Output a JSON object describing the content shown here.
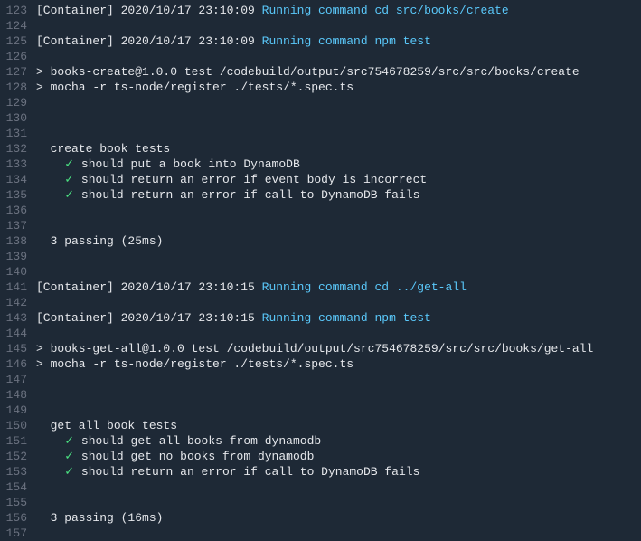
{
  "colors": {
    "bg": "#1e2936",
    "text": "#e5e7eb",
    "lineNumber": "#6b7280",
    "cyan": "#5ac8fa",
    "check": "#4ade80"
  },
  "lines": [
    {
      "num": 123,
      "segments": [
        {
          "text": "[Container] 2020/10/17 23:10:09 ",
          "cls": ""
        },
        {
          "text": "Running command cd src/books/create",
          "cls": "cyan"
        }
      ]
    },
    {
      "num": 124,
      "segments": []
    },
    {
      "num": 125,
      "segments": [
        {
          "text": "[Container] 2020/10/17 23:10:09 ",
          "cls": ""
        },
        {
          "text": "Running command npm test",
          "cls": "cyan"
        }
      ]
    },
    {
      "num": 126,
      "segments": []
    },
    {
      "num": 127,
      "segments": [
        {
          "text": "> books-create@1.0.0 test /codebuild/output/src754678259/src/src/books/create",
          "cls": ""
        }
      ]
    },
    {
      "num": 128,
      "segments": [
        {
          "text": "> mocha -r ts-node/register ./tests/*.spec.ts",
          "cls": ""
        }
      ]
    },
    {
      "num": 129,
      "segments": []
    },
    {
      "num": 130,
      "segments": []
    },
    {
      "num": 131,
      "segments": []
    },
    {
      "num": 132,
      "segments": [
        {
          "text": "  create book tests",
          "cls": ""
        }
      ]
    },
    {
      "num": 133,
      "segments": [
        {
          "text": "    ",
          "cls": ""
        },
        {
          "text": "✓",
          "cls": "check"
        },
        {
          "text": " should put a book into DynamoDB",
          "cls": ""
        }
      ]
    },
    {
      "num": 134,
      "segments": [
        {
          "text": "    ",
          "cls": ""
        },
        {
          "text": "✓",
          "cls": "check"
        },
        {
          "text": " should return an error if event body is incorrect",
          "cls": ""
        }
      ]
    },
    {
      "num": 135,
      "segments": [
        {
          "text": "    ",
          "cls": ""
        },
        {
          "text": "✓",
          "cls": "check"
        },
        {
          "text": " should return an error if call to DynamoDB fails",
          "cls": ""
        }
      ]
    },
    {
      "num": 136,
      "segments": []
    },
    {
      "num": 137,
      "segments": []
    },
    {
      "num": 138,
      "segments": [
        {
          "text": "  3 passing (25ms)",
          "cls": ""
        }
      ]
    },
    {
      "num": 139,
      "segments": []
    },
    {
      "num": 140,
      "segments": []
    },
    {
      "num": 141,
      "segments": [
        {
          "text": "[Container] 2020/10/17 23:10:15 ",
          "cls": ""
        },
        {
          "text": "Running command cd ../get-all",
          "cls": "cyan"
        }
      ]
    },
    {
      "num": 142,
      "segments": []
    },
    {
      "num": 143,
      "segments": [
        {
          "text": "[Container] 2020/10/17 23:10:15 ",
          "cls": ""
        },
        {
          "text": "Running command npm test",
          "cls": "cyan"
        }
      ]
    },
    {
      "num": 144,
      "segments": []
    },
    {
      "num": 145,
      "segments": [
        {
          "text": "> books-get-all@1.0.0 test /codebuild/output/src754678259/src/src/books/get-all",
          "cls": ""
        }
      ]
    },
    {
      "num": 146,
      "segments": [
        {
          "text": "> mocha -r ts-node/register ./tests/*.spec.ts",
          "cls": ""
        }
      ]
    },
    {
      "num": 147,
      "segments": []
    },
    {
      "num": 148,
      "segments": []
    },
    {
      "num": 149,
      "segments": []
    },
    {
      "num": 150,
      "segments": [
        {
          "text": "  get all book tests",
          "cls": ""
        }
      ]
    },
    {
      "num": 151,
      "segments": [
        {
          "text": "    ",
          "cls": ""
        },
        {
          "text": "✓",
          "cls": "check"
        },
        {
          "text": " should get all books from dynamodb",
          "cls": ""
        }
      ]
    },
    {
      "num": 152,
      "segments": [
        {
          "text": "    ",
          "cls": ""
        },
        {
          "text": "✓",
          "cls": "check"
        },
        {
          "text": " should get no books from dynamodb",
          "cls": ""
        }
      ]
    },
    {
      "num": 153,
      "segments": [
        {
          "text": "    ",
          "cls": ""
        },
        {
          "text": "✓",
          "cls": "check"
        },
        {
          "text": " should return an error if call to DynamoDB fails",
          "cls": ""
        }
      ]
    },
    {
      "num": 154,
      "segments": []
    },
    {
      "num": 155,
      "segments": []
    },
    {
      "num": 156,
      "segments": [
        {
          "text": "  3 passing (16ms)",
          "cls": ""
        }
      ]
    },
    {
      "num": 157,
      "segments": []
    }
  ]
}
